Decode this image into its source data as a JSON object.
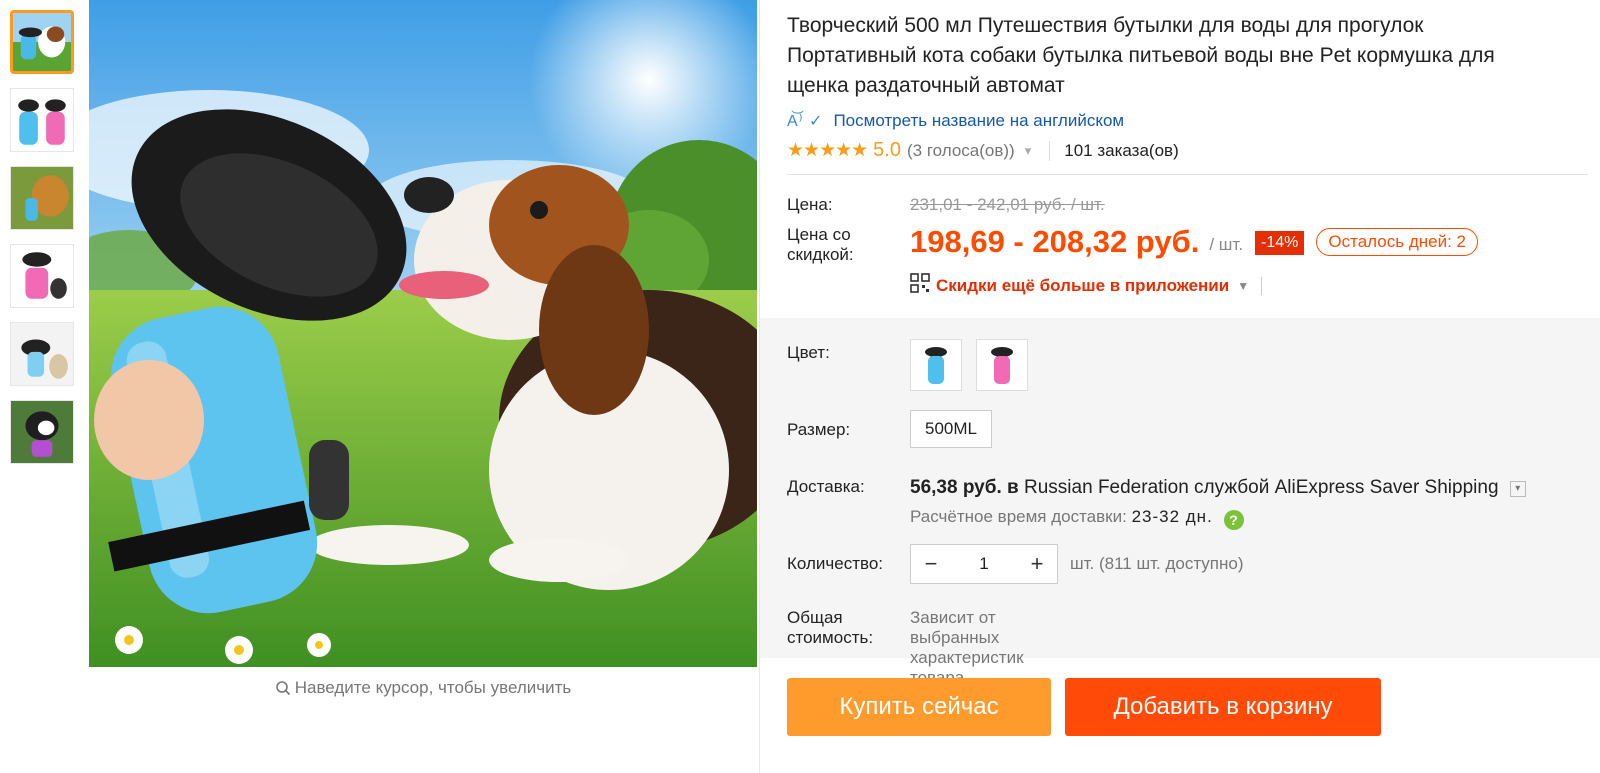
{
  "thumbnails": [
    {
      "label": "",
      "icon": "dog-drinking-image"
    },
    {
      "label": "",
      "icon": "blue-pink-bottles-image"
    },
    {
      "label": "",
      "icon": "golden-dog-image"
    },
    {
      "label": "",
      "icon": "pink-bottle-image"
    },
    {
      "label": "",
      "icon": "bottle-cat-image"
    },
    {
      "label": "",
      "icon": "person-dog-image"
    }
  ],
  "gallery": {
    "zoom_hint": "Наведите курсор, чтобы увеличить"
  },
  "product": {
    "title": "Творческий 500 мл Путешествия бутылки для воды для прогулок Портативный кота собаки бутылка питьевой воды вне Pet кормушка для щенка раздаточный автомат",
    "translate_link": "Посмотреть название на английском",
    "stars": "★★★★★",
    "rating": "5.0",
    "votes": "(3 голоса(ов))",
    "orders": "101 заказа(ов)"
  },
  "pricing": {
    "price_label": "Цена:",
    "original_price": "231,01 - 242,01 руб. / шт.",
    "discount_label": "Цена со скидкой:",
    "discount_price": "198,69 - 208,32 руб.",
    "per_unit": "/ шт.",
    "discount_pct": "-14%",
    "days_left": "Осталось дней: 2",
    "app_discount": "Скидки ещё больше в приложении"
  },
  "options": {
    "color_label": "Цвет:",
    "size_label": "Размер:",
    "size_value": "500ML",
    "shipping_label": "Доставка:",
    "shipping_price": "56,38 руб. в",
    "shipping_dest": "Russian Federation службой AliExpress Saver Shipping",
    "delivery_time_label": "Расчётное время доставки:",
    "delivery_days": "23-32 дн.",
    "quantity_label": "Количество:",
    "quantity_value": "1",
    "quantity_minus": "−",
    "quantity_plus": "+",
    "quantity_note": "шт. (811 шт. доступно)",
    "total_label": "Общая стоимость:",
    "total_text": "Зависит от выбранных характеристик товара"
  },
  "actions": {
    "buy_now": "Купить сейчас",
    "add_to_cart": "Добавить в корзину"
  },
  "colors": {
    "accent": "#ff4b00",
    "buy_button": "#ff9a2d",
    "cart_button": "#ff4b07",
    "link": "#1558b0",
    "badge": "#e62e04"
  }
}
